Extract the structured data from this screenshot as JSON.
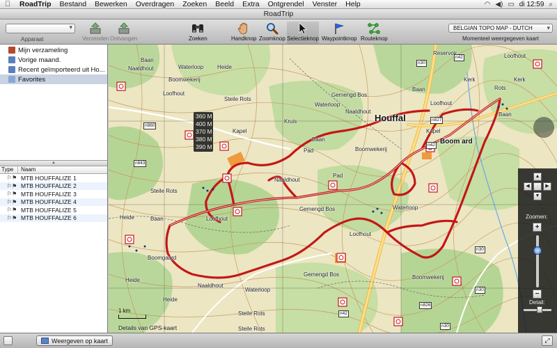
{
  "menubar": {
    "app": "RoadTrip",
    "items": [
      "Bestand",
      "Bewerken",
      "Overdragen",
      "Zoeken",
      "Beeld",
      "Extra",
      "Ontgrendel",
      "Venster",
      "Help"
    ],
    "clock": "di 12:59"
  },
  "window": {
    "title": "RoadTrip"
  },
  "toolbar": {
    "device_label": "Apparaat",
    "send": "Verzenden",
    "receive": "Ontvangen",
    "search": "Zoeken",
    "hand": "Handknop",
    "zoom": "Zoomknop",
    "select": "Selectieknop",
    "waypoint": "Waypointknop",
    "route": "Routeknop",
    "map_select": "BELGIAN TOPO MAP - DUTCH",
    "map_label": "Momenteel weergegeven kaart"
  },
  "collections": [
    {
      "label": "Mijn verzameling",
      "color": "#b34a2b"
    },
    {
      "label": "Vorige maand.",
      "color": "#5a7fbf"
    },
    {
      "label": "Recent geïmporteerd uit Ho...",
      "color": "#5a7fbf"
    },
    {
      "label": "Favorites",
      "color": "#8aa7d6"
    }
  ],
  "route_list": {
    "col_type": "Type",
    "col_name": "Naam",
    "rows": [
      "MTB HOUFFALIZE 1",
      "MTB HOUFFALIZE 2",
      "MTB HOUFFALIZE 3",
      "MTB HOUFFALIZE 4",
      "MTB HOUFFALIZE 5",
      "MTB HOUFFALIZE 6"
    ]
  },
  "map": {
    "town": "Houffal",
    "town2": "Boom ard",
    "credit": "Details van GPS-kaart",
    "scale": "1 km",
    "altitudes": [
      "360 M",
      "400 M",
      "370 M",
      "380 M",
      "390 M"
    ],
    "place_labels": [
      "Baan",
      "Naaldhout",
      "Heide",
      "Boomwekerij",
      "Loofhout",
      "Gemengd Bos",
      "Steile Rots",
      "Waterloop",
      "Pad",
      "Baan",
      "Naaldhout",
      "Heide",
      "Boomwekerij",
      "Loofhout",
      "Gemengd Bos",
      "Steile Rots",
      "Waterloop",
      "Naaldhout",
      "Baan",
      "Heide",
      "Boomgaard",
      "Waterloop",
      "Loofhout",
      "Gemengd Bos",
      "Steile Rots",
      "Boomwekerij",
      "Naaldhout",
      "Heide",
      "Loofhout",
      "Baan",
      "Kerk",
      "Kerk",
      "Rots",
      "Kapel",
      "Kapel",
      "Reservoir",
      "Kruis",
      "Pad",
      "Waterloop",
      "Loofhout",
      "Steile Rots",
      "Baan"
    ],
    "road_shields": [
      "n30",
      "n42",
      "n827",
      "n860",
      "n843",
      "n42",
      "n826",
      "n30",
      "n42",
      "n30",
      "n30"
    ],
    "zoom_label": "Zoomen:",
    "detail_label": "Detail:"
  },
  "statusbar": {
    "show_on_map": "Weergeven op kaart"
  }
}
